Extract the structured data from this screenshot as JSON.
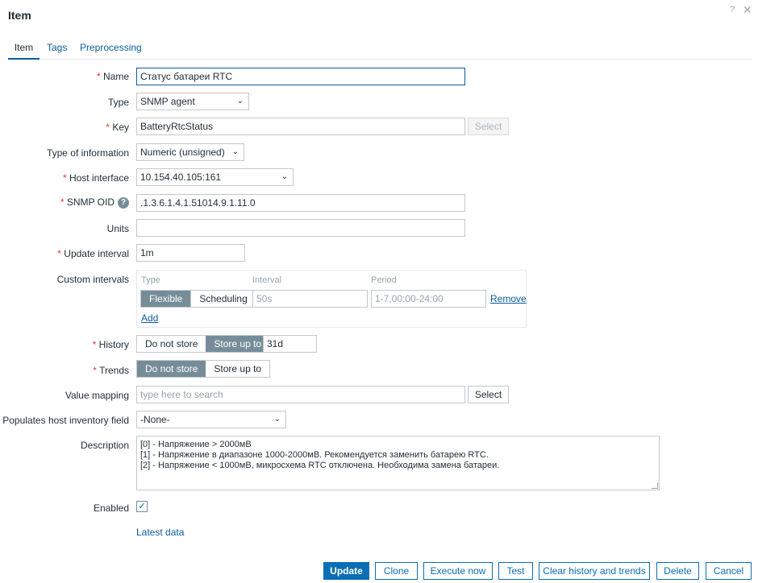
{
  "dialog": {
    "title": "Item",
    "help_glyph": "?",
    "close_glyph": "✕"
  },
  "tabs": [
    {
      "label": "Item"
    },
    {
      "label": "Tags"
    },
    {
      "label": "Preprocessing"
    }
  ],
  "form": {
    "required_mark": "*",
    "name": {
      "label": "Name",
      "value": "Статус батареи RTC"
    },
    "type": {
      "label": "Type",
      "value": "SNMP agent"
    },
    "key": {
      "label": "Key",
      "value": "BatteryRtcStatus",
      "select": "Select"
    },
    "type_of_information": {
      "label": "Type of information",
      "value": "Numeric (unsigned)"
    },
    "host_interface": {
      "label": "Host interface",
      "value": "10.154.40.105:161"
    },
    "snmp_oid": {
      "label": "SNMP OID",
      "help_glyph": "?",
      "value": ".1.3.6.1.4.1.51014.9.1.11.0"
    },
    "units": {
      "label": "Units",
      "value": ""
    },
    "update_interval": {
      "label": "Update interval",
      "value": "1m"
    },
    "custom_intervals": {
      "label": "Custom intervals",
      "headers": {
        "type": "Type",
        "interval": "Interval",
        "period": "Period"
      },
      "type_options": [
        "Flexible",
        "Scheduling"
      ],
      "interval_placeholder": "50s",
      "period_placeholder": "1-7,00:00-24:00",
      "remove": "Remove",
      "add": "Add"
    },
    "history": {
      "label": "History",
      "options": [
        "Do not store",
        "Store up to"
      ],
      "value": "31d"
    },
    "trends": {
      "label": "Trends",
      "options": [
        "Do not store",
        "Store up to"
      ]
    },
    "value_mapping": {
      "label": "Value mapping",
      "placeholder": "type here to search",
      "select": "Select"
    },
    "inventory": {
      "label": "Populates host inventory field",
      "value": "-None-"
    },
    "description": {
      "label": "Description",
      "lines": [
        "[0] - Напряжение > 2000мВ",
        "[1] - Напряжение в диапазоне 1000-2000мВ. Рекомендуется заменить батарею RTC.",
        "[2] - Напряжение < 1000мВ, микросхема RTC отключена. Необходима замена батареи."
      ]
    },
    "enabled": {
      "label": "Enabled",
      "checked": true,
      "check_glyph": "✓"
    },
    "latest_data": "Latest data"
  },
  "footer": {
    "update": "Update",
    "clone": "Clone",
    "execute_now": "Execute now",
    "test": "Test",
    "clear_history": "Clear history and trends",
    "delete": "Delete",
    "cancel": "Cancel"
  },
  "colors": {
    "accent": "#0a6eb4",
    "link": "#0a5c9e",
    "required": "#e33734",
    "segment_on": "#768d99"
  }
}
